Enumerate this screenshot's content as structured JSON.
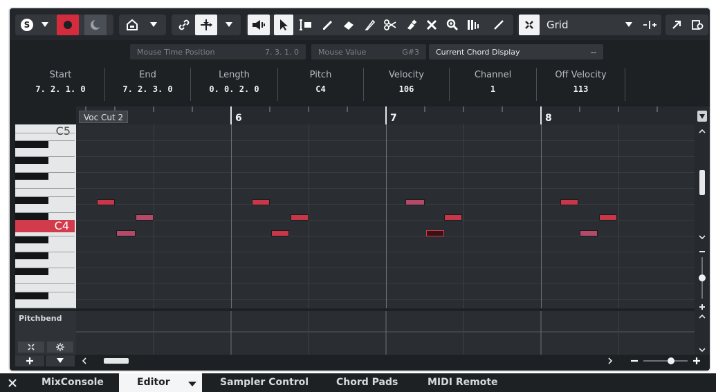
{
  "toolbar": {
    "snap_mode": "Grid",
    "icons": [
      "solo-icon",
      "dropdown-icon",
      "record-icon",
      "moon-icon",
      "inspector-icon",
      "dropdown-icon",
      "link-icon",
      "auto-scroll-icon",
      "dropdown-icon",
      "speaker-icon",
      "pointer-icon",
      "range-icon",
      "pencil-icon",
      "eraser-icon",
      "trim-icon",
      "split-icon",
      "glue-icon",
      "mute-icon",
      "zoom-icon",
      "quantize-icon",
      "line-icon",
      "snap-icon",
      "insert-icon",
      "open-window-icon",
      "settings-icon"
    ]
  },
  "info_strip": {
    "mouse_time_label": "Mouse Time Position",
    "mouse_time_value": "7. 3. 1.   0",
    "mouse_value_label": "Mouse Value",
    "mouse_value_value": "G#3",
    "chord_label": "Current Chord Display",
    "chord_value": "--"
  },
  "infoline": [
    {
      "label": "Start",
      "value": "7. 2. 1.   0"
    },
    {
      "label": "End",
      "value": "7. 2. 3.   0"
    },
    {
      "label": "Length",
      "value": "0. 0. 2.   0"
    },
    {
      "label": "Pitch",
      "value": "C4"
    },
    {
      "label": "Velocity",
      "value": "106"
    },
    {
      "label": "Channel",
      "value": "1"
    },
    {
      "label": "Off Velocity",
      "value": "113"
    }
  ],
  "editor": {
    "event_name": "Voc Cut 2",
    "bars": [
      "6",
      "7",
      "8"
    ],
    "keys": {
      "top": "C5",
      "selected": "C4"
    },
    "controller_lane": "Pitchbend"
  },
  "tabs": [
    {
      "label": "MixConsole",
      "selected": false
    },
    {
      "label": "Editor",
      "selected": true
    },
    {
      "label": "Sampler Control",
      "selected": false
    },
    {
      "label": "Chord Pads",
      "selected": false
    },
    {
      "label": "MIDI Remote",
      "selected": false
    }
  ],
  "colors": {
    "note_red": "#c8364a",
    "note_pink": "#b34a6a",
    "selected_key": "#d23b4c",
    "record": "#d42c3c"
  }
}
